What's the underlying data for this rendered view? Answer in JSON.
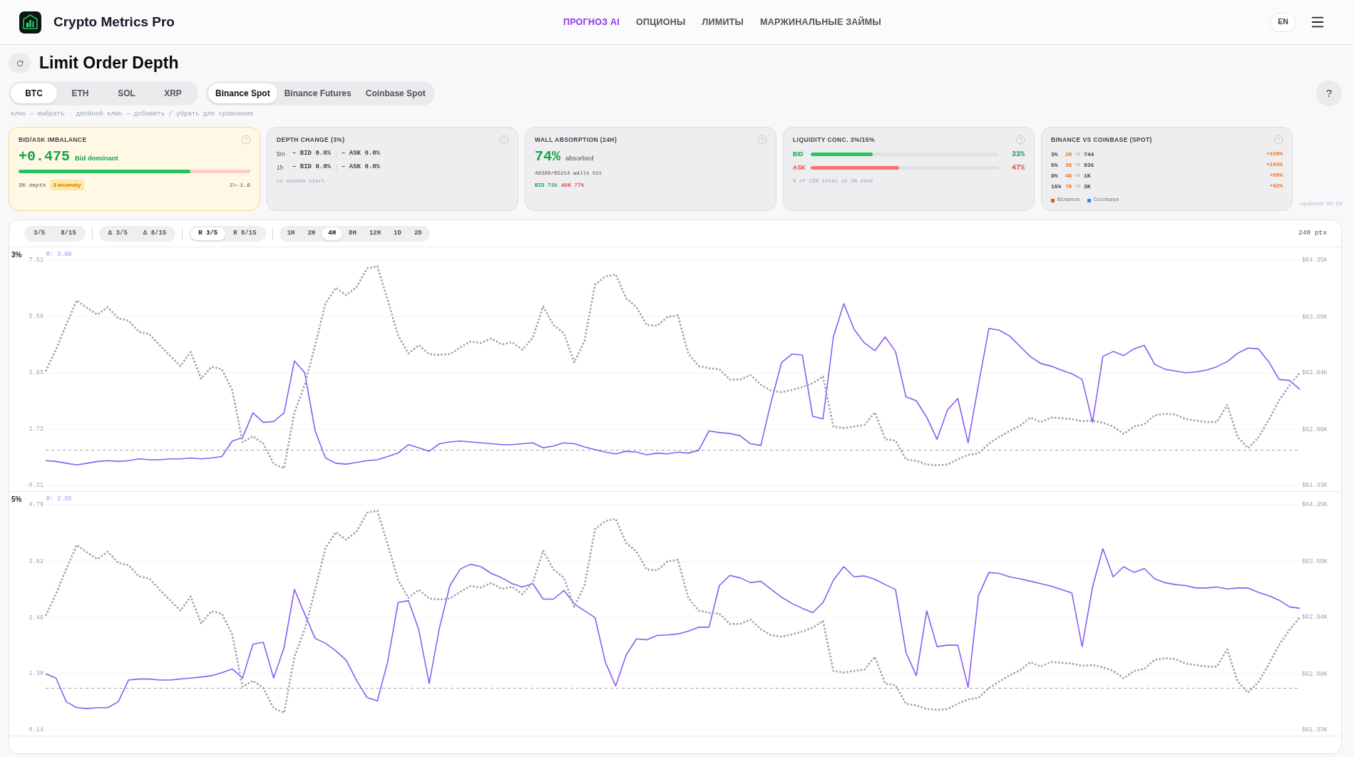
{
  "header": {
    "brand": "Crypto Metrics Pro",
    "nav": [
      {
        "label": "ПРОГНОЗ AI",
        "selected": true
      },
      {
        "label": "ОПЦИОНЫ",
        "selected": false
      },
      {
        "label": "ЛИМИТЫ",
        "selected": false
      },
      {
        "label": "МАРЖИНАЛЬНЫЕ ЗАЙМЫ",
        "selected": false
      }
    ],
    "language": "EN"
  },
  "page": {
    "title": "Limit Order Depth",
    "assets": [
      {
        "label": "BTC",
        "selected": true
      },
      {
        "label": "ETH",
        "selected": false
      },
      {
        "label": "SOL",
        "selected": false
      },
      {
        "label": "XRP",
        "selected": false
      }
    ],
    "sources": [
      {
        "label": "Binance Spot",
        "selected": true
      },
      {
        "label": "Binance Futures",
        "selected": false
      },
      {
        "label": "Coinbase Spot",
        "selected": false
      }
    ],
    "help": "?",
    "hint": "клик — выбрать · двойной клик — добавить / убрать для сравнения"
  },
  "cards": [
    {
      "kind": "imbalance",
      "highlighted": true,
      "title": "BID/ASK IMBALANCE",
      "value": "+0.475",
      "caption": "Bid dominant",
      "level": 0.74,
      "depth": "3% depth",
      "badge": "3 anomaly",
      "z": "Z=-1.6"
    },
    {
      "kind": "depth_change",
      "highlighted": false,
      "title": "DEPTH CHANGE (3%)",
      "rows": [
        {
          "period": "5m",
          "bid": "– BID 0.0%",
          "ask": "– ASK 0.0%"
        },
        {
          "period": "1h",
          "bid": "– BID 0.0%",
          "ask": "– ASK 0.0%"
        }
      ],
      "note": "vs window start"
    },
    {
      "kind": "absorption",
      "highlighted": false,
      "title": "WALL ABSORPTION (24H)",
      "value": "74%",
      "caption": "absorbed",
      "detail": "48399/65214 walls hit",
      "sides": [
        {
          "kind": "bid",
          "text": "BID 71%"
        },
        {
          "kind": "ask",
          "text": "ASK 77%"
        }
      ]
    },
    {
      "kind": "concentration",
      "highlighted": false,
      "title": "LIQUIDITY CONC. 3%/15%",
      "rows": [
        {
          "kind": "bid",
          "label": "BID",
          "level": 0.33,
          "value": "33%"
        },
        {
          "kind": "ask",
          "label": "ASK",
          "level": 0.47,
          "value": "47%"
        }
      ],
      "note": "% of 15% total in 3% zone"
    },
    {
      "kind": "comparison",
      "highlighted": false,
      "title": "BINANCE VS COINBASE (SPOT)",
      "rows": [
        {
          "depth": "3%",
          "binance": "2K",
          "vs": "vs",
          "coinbase": "744",
          "diff": "+108%"
        },
        {
          "depth": "5%",
          "binance": "3K",
          "vs": "vs",
          "coinbase": "936",
          "diff": "+104%"
        },
        {
          "depth": "8%",
          "binance": "4K",
          "vs": "vs",
          "coinbase": "1K",
          "diff": "+99%"
        },
        {
          "depth": "15%",
          "binance": "7K",
          "vs": "vs",
          "coinbase": "3K",
          "diff": "+82%"
        }
      ],
      "legend": [
        {
          "label": "Binance",
          "color": "#ea580c"
        },
        {
          "label": "Coinbase",
          "color": "#3b82f6"
        }
      ]
    }
  ],
  "updated": "updated 09:59",
  "chart_panel": {
    "toolbar": [
      {
        "options": [
          {
            "label": "3/5",
            "selected": false
          },
          {
            "label": "8/15",
            "selected": false
          }
        ]
      },
      {
        "options": [
          {
            "label": "Δ 3/5",
            "selected": false
          },
          {
            "label": "Δ 8/15",
            "selected": false
          }
        ]
      },
      {
        "options": [
          {
            "label": "R 3/5",
            "selected": true
          },
          {
            "label": "R 8/15",
            "selected": false
          }
        ]
      },
      {
        "options": [
          {
            "label": "1H",
            "selected": false
          },
          {
            "label": "2H",
            "selected": false
          },
          {
            "label": "4H",
            "selected": true
          },
          {
            "label": "8H",
            "selected": false
          },
          {
            "label": "12H",
            "selected": false
          },
          {
            "label": "1D",
            "selected": false
          },
          {
            "label": "2D",
            "selected": false
          }
        ]
      }
    ],
    "points": "240 pts",
    "charts": [
      {
        "reading": "R: 3.08",
        "chart_data": {
          "type": "line",
          "title": "3%",
          "grid": true,
          "ylim": [
            -0.21,
            7.51
          ],
          "yticks": [
            -0.21,
            1.72,
            3.65,
            5.58,
            7.51
          ],
          "y2lim": [
            61.33,
            64.35
          ],
          "y2ticks": [
            {
              "value": 61.33,
              "label": "$61.33K"
            },
            {
              "value": 62.08,
              "label": "$62.08K"
            },
            {
              "value": 62.84,
              "label": "$62.84K"
            },
            {
              "value": 63.59,
              "label": "$63.59K"
            },
            {
              "value": 64.35,
              "label": "$64.35K"
            }
          ],
          "ref_lines": [
            {
              "axis": "y",
              "value": 1
            }
          ],
          "series": [
            {
              "color": "#8b5cf6",
              "values": [
                0.64,
                0.61,
                0.55,
                0.49,
                0.55,
                0.61,
                0.64,
                0.61,
                0.64,
                0.7,
                0.67,
                0.67,
                0.7,
                0.7,
                0.73,
                0.7,
                0.73,
                0.78,
                1.31,
                1.43,
                2.28,
                1.95,
                1.98,
                2.28,
                4.06,
                3.65,
                1.66,
                0.73,
                0.55,
                0.52,
                0.58,
                0.64,
                0.67,
                0.78,
                0.9,
                1.19,
                1.08,
                0.96,
                1.22,
                1.28,
                1.31,
                1.28,
                1.25,
                1.22,
                1.19,
                1.19,
                1.22,
                1.25,
                1.08,
                1.14,
                1.25,
                1.22,
                1.11,
                1.02,
                0.93,
                0.87,
                0.96,
                0.93,
                0.84,
                0.9,
                0.87,
                0.93,
                0.9,
                0.99,
                1.66,
                1.6,
                1.57,
                1.49,
                1.22,
                1.16,
                2.66,
                4.0,
                4.29,
                4.26,
                2.16,
                2.07,
                4.88,
                6.02,
                5.14,
                4.67,
                4.41,
                4.88,
                4.38,
                2.83,
                2.69,
                2.13,
                1.37,
                2.37,
                2.77,
                1.25,
                3.24,
                5.17,
                5.11,
                4.91,
                4.56,
                4.21,
                3.97,
                3.88,
                3.74,
                3.62,
                3.42,
                1.95,
                4.21,
                4.38,
                4.24,
                4.47,
                4.59,
                3.94,
                3.77,
                3.71,
                3.65,
                3.68,
                3.74,
                3.86,
                4.03,
                4.32,
                4.5,
                4.47,
                4.03,
                3.42,
                3.39,
                3.08
              ]
            },
            {
              "axis": "y2",
              "color": "#9ca3af",
              "line_style": "dotted",
              "values": [
                62.86,
                63.15,
                63.49,
                63.81,
                63.71,
                63.62,
                63.72,
                63.57,
                63.54,
                63.39,
                63.36,
                63.21,
                63.07,
                62.93,
                63.12,
                62.76,
                62.92,
                62.89,
                62.61,
                61.91,
                61.99,
                61.89,
                61.62,
                61.56,
                62.31,
                62.68,
                63.21,
                63.77,
                63.98,
                63.88,
                63.99,
                64.24,
                64.27,
                63.82,
                63.34,
                63.1,
                63.21,
                63.09,
                63.08,
                63.09,
                63.18,
                63.26,
                63.24,
                63.3,
                63.22,
                63.25,
                63.15,
                63.31,
                63.73,
                63.48,
                63.37,
                62.98,
                63.27,
                64.02,
                64.13,
                64.16,
                63.84,
                63.72,
                63.48,
                63.47,
                63.59,
                63.61,
                63.1,
                62.93,
                62.9,
                62.89,
                62.75,
                62.75,
                62.81,
                62.68,
                62.6,
                62.58,
                62.61,
                62.65,
                62.7,
                62.79,
                62.12,
                62.1,
                62.12,
                62.14,
                62.31,
                61.95,
                61.93,
                61.68,
                61.66,
                61.61,
                61.6,
                61.61,
                61.68,
                61.74,
                61.76,
                61.89,
                61.98,
                62.06,
                62.13,
                62.24,
                62.18,
                62.24,
                62.23,
                62.22,
                62.19,
                62.2,
                62.17,
                62.12,
                62.02,
                62.12,
                62.15,
                62.27,
                62.29,
                62.28,
                62.22,
                62.2,
                62.18,
                62.18,
                62.41,
                61.98,
                61.83,
                61.97,
                62.21,
                62.47,
                62.67,
                62.84
              ]
            }
          ]
        }
      },
      {
        "reading": "R: 2.65",
        "chart_data": {
          "type": "line",
          "title": "5%",
          "grid": true,
          "ylim": [
            0.14,
            4.79
          ],
          "yticks": [
            0.14,
            {
              "value": 1.3,
              "label": "1.30"
            },
            2.46,
            3.62,
            4.79
          ],
          "y2lim": [
            61.33,
            64.35
          ],
          "y2ticks": [
            {
              "value": 61.33,
              "label": "$61.33K"
            },
            {
              "value": 62.08,
              "label": "$62.08K"
            },
            {
              "value": 62.84,
              "label": "$62.84K"
            },
            {
              "value": 63.59,
              "label": "$63.59K"
            },
            {
              "value": 64.35,
              "label": "$64.35K"
            }
          ],
          "ref_lines": [
            {
              "axis": "y",
              "value": 1
            }
          ],
          "series": [
            {
              "color": "#8b5cf6",
              "values": [
                1.3,
                1.21,
                0.72,
                0.6,
                0.58,
                0.6,
                0.6,
                0.72,
                1.17,
                1.19,
                1.19,
                1.17,
                1.17,
                1.19,
                1.21,
                1.23,
                1.26,
                1.32,
                1.4,
                1.21,
                1.91,
                1.95,
                1.21,
                1.84,
                3.04,
                2.53,
                2.03,
                1.93,
                1.77,
                1.58,
                1.16,
                0.81,
                0.74,
                1.54,
                2.77,
                2.81,
                2.21,
                1.1,
                2.25,
                3.12,
                3.46,
                3.56,
                3.51,
                3.37,
                3.28,
                3.16,
                3.09,
                3.16,
                2.84,
                2.84,
                3.02,
                2.74,
                2.6,
                2.46,
                1.54,
                1.05,
                1.68,
                2.02,
                2.0,
                2.09,
                2.1,
                2.12,
                2.18,
                2.26,
                2.26,
                3.12,
                3.33,
                3.28,
                3.18,
                3.21,
                3.04,
                2.88,
                2.75,
                2.65,
                2.56,
                2.77,
                3.23,
                3.51,
                3.3,
                3.32,
                3.25,
                3.14,
                3.04,
                1.74,
                1.26,
                2.6,
                1.86,
                1.89,
                1.89,
                1.02,
                2.91,
                3.39,
                3.37,
                3.3,
                3.26,
                3.21,
                3.16,
                3.11,
                3.04,
                2.97,
                1.86,
                3.09,
                3.88,
                3.3,
                3.51,
                3.39,
                3.47,
                3.26,
                3.18,
                3.14,
                3.12,
                3.07,
                3.07,
                3.09,
                3.05,
                3.07,
                3.07,
                2.98,
                2.91,
                2.82,
                2.68,
                2.65
              ]
            },
            {
              "axis": "y2",
              "color": "#9ca3af",
              "line_style": "dotted",
              "values": [
                62.86,
                63.15,
                63.49,
                63.81,
                63.71,
                63.62,
                63.72,
                63.57,
                63.54,
                63.39,
                63.36,
                63.21,
                63.07,
                62.93,
                63.12,
                62.76,
                62.92,
                62.89,
                62.61,
                61.91,
                61.99,
                61.89,
                61.62,
                61.56,
                62.31,
                62.68,
                63.21,
                63.77,
                63.98,
                63.88,
                63.99,
                64.24,
                64.27,
                63.82,
                63.34,
                63.1,
                63.21,
                63.09,
                63.08,
                63.09,
                63.18,
                63.26,
                63.24,
                63.3,
                63.22,
                63.25,
                63.15,
                63.31,
                63.73,
                63.48,
                63.37,
                62.98,
                63.27,
                64.02,
                64.13,
                64.16,
                63.84,
                63.72,
                63.48,
                63.47,
                63.59,
                63.61,
                63.1,
                62.93,
                62.9,
                62.89,
                62.75,
                62.75,
                62.81,
                62.68,
                62.6,
                62.58,
                62.61,
                62.65,
                62.7,
                62.79,
                62.12,
                62.1,
                62.12,
                62.14,
                62.31,
                61.95,
                61.93,
                61.68,
                61.66,
                61.61,
                61.6,
                61.61,
                61.68,
                61.74,
                61.76,
                61.89,
                61.98,
                62.06,
                62.13,
                62.24,
                62.18,
                62.24,
                62.23,
                62.22,
                62.19,
                62.2,
                62.17,
                62.12,
                62.02,
                62.12,
                62.15,
                62.27,
                62.29,
                62.28,
                62.22,
                62.2,
                62.18,
                62.18,
                62.41,
                61.98,
                61.83,
                61.97,
                62.21,
                62.47,
                62.67,
                62.84
              ]
            }
          ]
        }
      }
    ]
  }
}
